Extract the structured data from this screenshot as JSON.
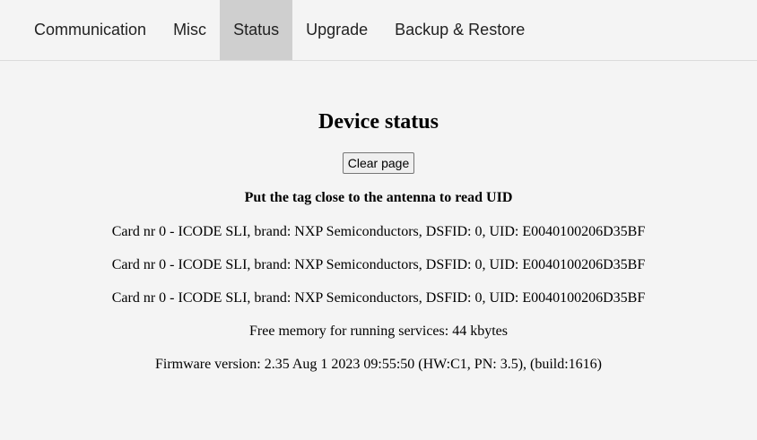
{
  "nav": {
    "items": [
      {
        "label": "Communication",
        "active": false
      },
      {
        "label": "Misc",
        "active": false
      },
      {
        "label": "Status",
        "active": true
      },
      {
        "label": "Upgrade",
        "active": false
      },
      {
        "label": "Backup & Restore",
        "active": false
      }
    ]
  },
  "main": {
    "title": "Device status",
    "clear_button": "Clear page",
    "instruction": "Put the tag close to the antenna to read UID",
    "cards": [
      "Card nr 0 - ICODE SLI, brand: NXP Semiconductors, DSFID: 0, UID: E0040100206D35BF",
      "Card nr 0 - ICODE SLI, brand: NXP Semiconductors, DSFID: 0, UID: E0040100206D35BF",
      "Card nr 0 - ICODE SLI, brand: NXP Semiconductors, DSFID: 0, UID: E0040100206D35BF"
    ],
    "free_memory": "Free memory for running services: 44 kbytes",
    "firmware": "Firmware version: 2.35 Aug 1 2023 09:55:50 (HW:C1, PN: 3.5), (build:1616)"
  },
  "colors": {
    "background": "#f4f4f4",
    "active_tab": "#cfcfcf"
  }
}
